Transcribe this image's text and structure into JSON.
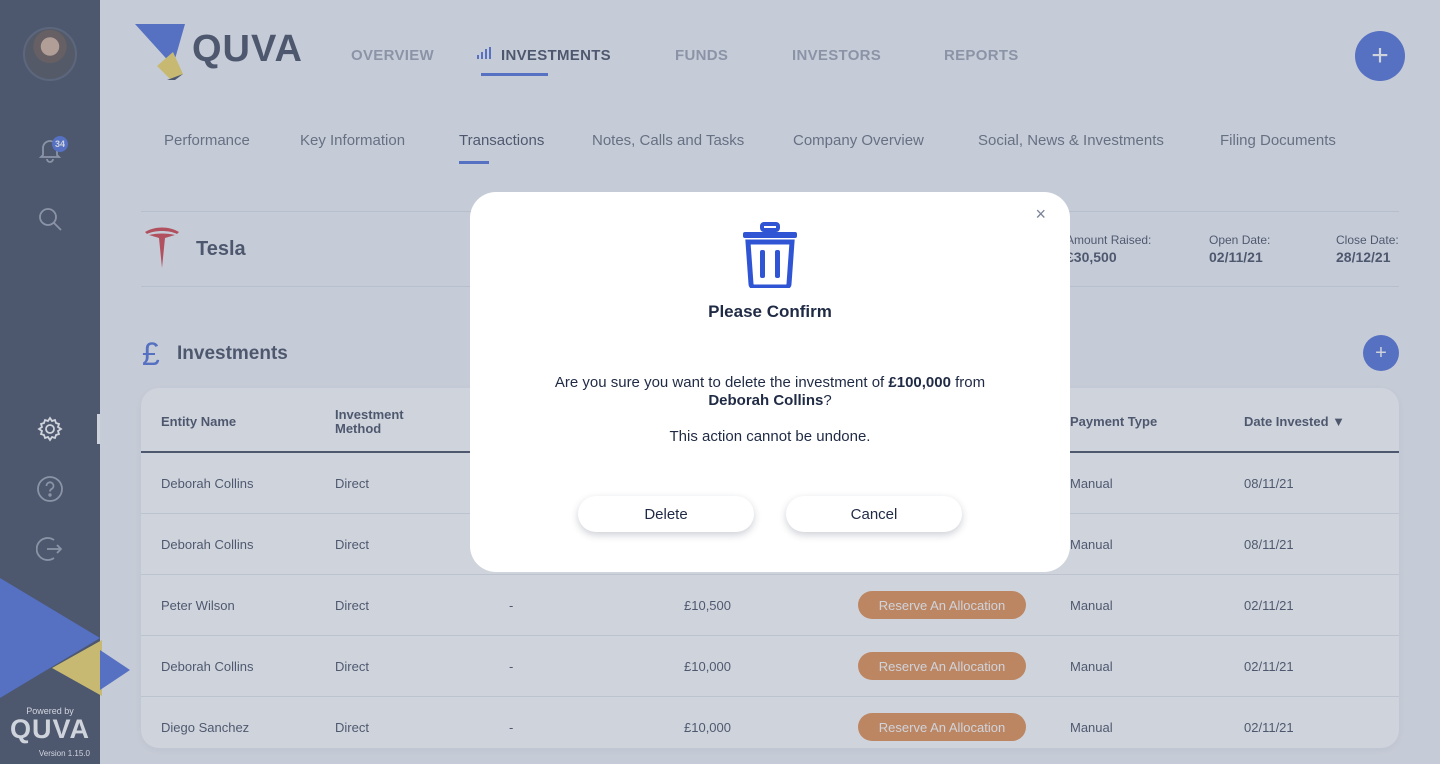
{
  "sidebar": {
    "notification_count": "34",
    "powered_by": "Powered by",
    "brand": "QUVA",
    "version": "Version 1.15.0"
  },
  "header": {
    "logo_text": "QUVA",
    "nav": [
      "OVERVIEW",
      "INVESTMENTS",
      "FUNDS",
      "INVESTORS",
      "REPORTS"
    ],
    "active_nav": "INVESTMENTS",
    "add_label": "+"
  },
  "sub_tabs": [
    "Performance",
    "Key Information",
    "Transactions",
    "Notes, Calls and Tasks",
    "Company Overview",
    "Social, News & Investments",
    "Filing Documents"
  ],
  "company": {
    "name": "Tesla",
    "stats": [
      {
        "label": "Amount Raised:",
        "value": "£30,500"
      },
      {
        "label": "Open Date:",
        "value": "02/11/21"
      },
      {
        "label": "Close Date:",
        "value": "28/12/21"
      }
    ]
  },
  "investments": {
    "title": "Investments",
    "add_label": "+",
    "headers": {
      "entity": "Entity Name",
      "method_1": "Investment",
      "method_2": "Method",
      "payment": "Payment Type",
      "date": "Date Invested ▼"
    },
    "rows": [
      {
        "entity": "Deborah Collins",
        "method": "Direct",
        "ref": "",
        "amount": "",
        "status": "",
        "payment": "Manual",
        "date": "08/11/21"
      },
      {
        "entity": "Deborah Collins",
        "method": "Direct",
        "ref": "",
        "amount": "",
        "status": "",
        "payment": "Manual",
        "date": "08/11/21"
      },
      {
        "entity": "Peter Wilson",
        "method": "Direct",
        "ref": "-",
        "amount": "£10,500",
        "status": "Reserve An Allocation",
        "payment": "Manual",
        "date": "02/11/21"
      },
      {
        "entity": "Deborah Collins",
        "method": "Direct",
        "ref": "-",
        "amount": "£10,000",
        "status": "Reserve An Allocation",
        "payment": "Manual",
        "date": "02/11/21"
      },
      {
        "entity": "Diego Sanchez",
        "method": "Direct",
        "ref": "-",
        "amount": "£10,000",
        "status": "Reserve An Allocation",
        "payment": "Manual",
        "date": "02/11/21"
      }
    ]
  },
  "modal": {
    "close": "×",
    "title": "Please Confirm",
    "msg_prefix": "Are you sure you want to delete the investment of ",
    "amount": "£100,000",
    "msg_mid": " from",
    "name": "Deborah Collins",
    "msg_suffix": "?",
    "note": "This action cannot be undone.",
    "delete_label": "Delete",
    "cancel_label": "Cancel"
  },
  "colors": {
    "navy": "#1f2a44",
    "brand_blue": "#2f55d4",
    "brand_yellow": "#f3d34a",
    "pill_orange": "#e07a2f"
  }
}
